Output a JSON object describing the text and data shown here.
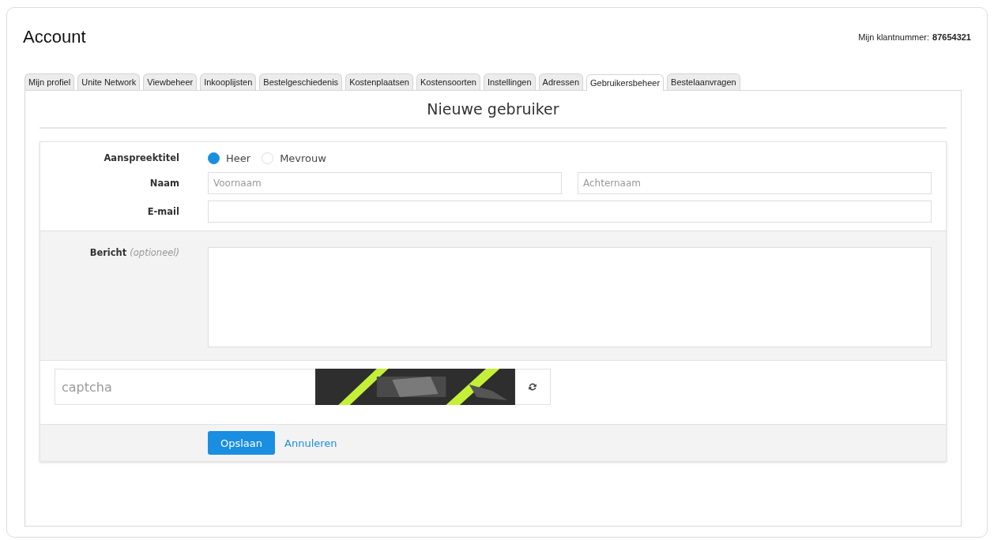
{
  "page": {
    "title": "Account",
    "customer_number_label": "Mijn klantnummer:",
    "customer_number": "87654321"
  },
  "tabs": [
    {
      "label": "Mijn profiel",
      "selected": false
    },
    {
      "label": "Unite Network",
      "selected": false
    },
    {
      "label": "Viewbeheer",
      "selected": false
    },
    {
      "label": "Inkooplijsten",
      "selected": false
    },
    {
      "label": "Bestelgeschiedenis",
      "selected": false
    },
    {
      "label": "Kostenplaatsen",
      "selected": false
    },
    {
      "label": "Kostensoorten",
      "selected": false
    },
    {
      "label": "Instellingen",
      "selected": false
    },
    {
      "label": "Adressen",
      "selected": false
    },
    {
      "label": "Gebruikersbeheer",
      "selected": true
    },
    {
      "label": "Bestelaanvragen",
      "selected": false
    }
  ],
  "form": {
    "heading": "Nieuwe gebruiker",
    "salutation": {
      "label": "Aanspreektitel",
      "options": [
        {
          "label": "Heer",
          "selected": true
        },
        {
          "label": "Mevrouw",
          "selected": false
        }
      ]
    },
    "name": {
      "label": "Naam",
      "first_placeholder": "Voornaam",
      "last_placeholder": "Achternaam"
    },
    "email": {
      "label": "E-mail"
    },
    "message": {
      "label": "Bericht",
      "hint": "(optioneel)"
    },
    "captcha": {
      "placeholder": "captcha"
    },
    "buttons": {
      "save": "Opslaan",
      "cancel": "Annuleren"
    }
  }
}
